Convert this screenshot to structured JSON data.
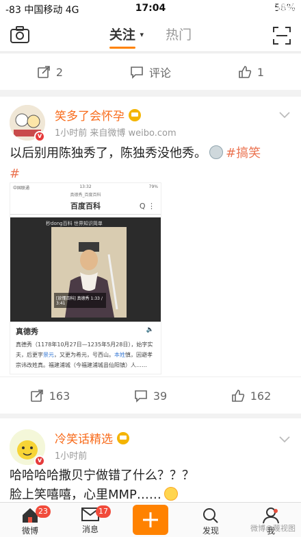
{
  "status_bar": {
    "carrier": "-83 中国移动 4G",
    "time": "17:04",
    "battery": "58%"
  },
  "watermark": "百思不得姐",
  "nav": {
    "tab_follow": "关注",
    "tab_hot": "热门"
  },
  "top_actions": {
    "repost": "2",
    "comment": "评论",
    "like": "1"
  },
  "post1": {
    "user": "笑多了会怀孕",
    "meta": "1小时前  来自微博 weibo.com",
    "text_line1": "以后别用陈独秀了，陈独秀没他秀。",
    "topic": "#搞笑",
    "text_line2": "#",
    "shot": {
      "carrier": "中国联通",
      "time": "13:32",
      "battery": "79%",
      "url": "真德秀_百度百科",
      "brand": "百度百科",
      "icons": "Q ⋮",
      "watermark": "秒dong百科 世界知识简单",
      "play": "[放懂百科] 真德秀  1:33 / 3:41",
      "title": "真德秀",
      "speaker": "🔈",
      "desc_a": "真德秀（1178年10月27日—1235年5月28日），始字实夫，后更字",
      "desc_link1": "景元",
      "desc_b": "，又更为希元，号西山。",
      "desc_link2": "本姓",
      "desc_c": "慎，因避孝宗讳改姓真。福建浦城（今福建浦城县仙阳镇）人……"
    },
    "actions": {
      "repost": "163",
      "comment": "39",
      "like": "162"
    }
  },
  "post2": {
    "user": "冷笑话精选",
    "meta": "1小时前",
    "text_line1": "哈哈哈哈撒贝宁做错了什么？？？",
    "text_line2": "脸上笑嘻嘻，心里MMP……"
  },
  "tabbar": {
    "home": "微博",
    "home_badge": "23",
    "messages": "消息",
    "messages_badge": "17",
    "discover": "发现",
    "me": "我"
  },
  "bottom_watermark": "微博@蔑视图"
}
